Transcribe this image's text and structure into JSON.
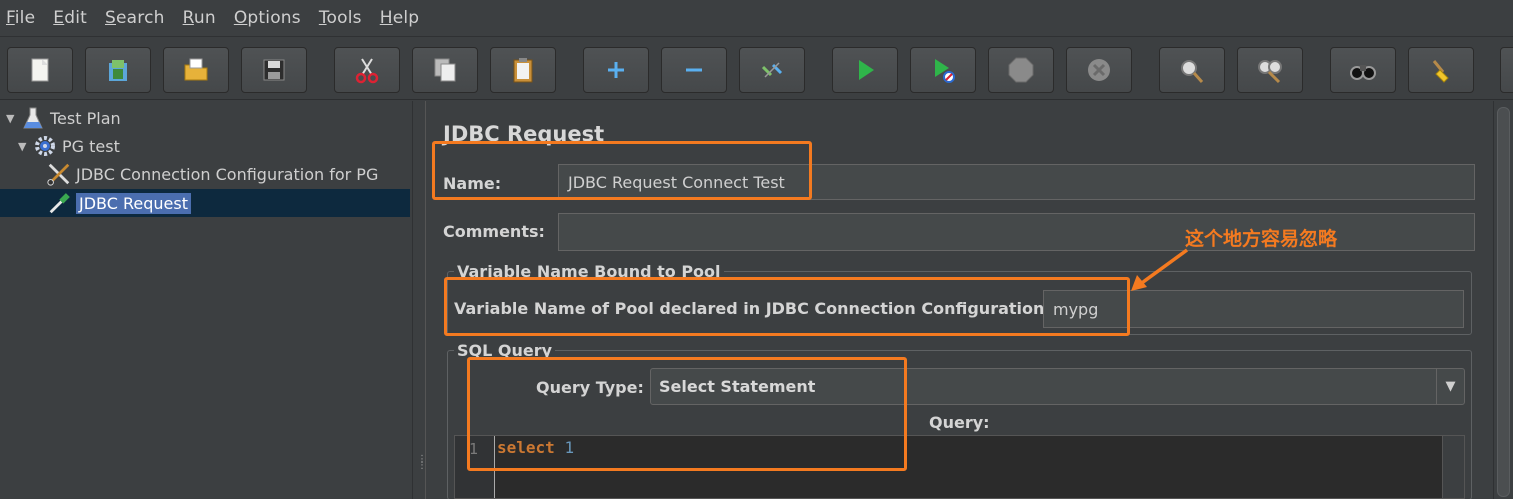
{
  "menu": {
    "items": [
      {
        "key": "F",
        "rest": "ile"
      },
      {
        "key": "E",
        "rest": "dit"
      },
      {
        "key": "S",
        "rest": "earch"
      },
      {
        "key": "R",
        "rest": "un"
      },
      {
        "key": "O",
        "rest": "ptions"
      },
      {
        "key": "T",
        "rest": "ools"
      },
      {
        "key": "H",
        "rest": "elp"
      }
    ]
  },
  "toolbar": {
    "buttons": [
      "new-icon",
      "templates-icon",
      "open-icon",
      "save-icon",
      "cut-icon",
      "copy-icon",
      "paste-icon",
      "expand-icon",
      "collapse-icon",
      "toggle-icon",
      "start-icon",
      "start-no-pause-icon",
      "stop-icon",
      "shutdown-icon",
      "clear-icon",
      "clear-all-icon",
      "search-icon",
      "reset-search-icon"
    ]
  },
  "tree": {
    "test_plan": "Test Plan",
    "thread_group": "PG test",
    "connection_config": "JDBC Connection Configuration for PG",
    "jdbc_request": "JDBC Request"
  },
  "form": {
    "title": "JDBC Request",
    "name_label": "Name:",
    "name_value": "JDBC Request Connect Test",
    "comments_label": "Comments:",
    "comments_value": "",
    "pool_group_title": "Variable Name Bound to Pool",
    "pool_label": "Variable Name of Pool declared in JDBC Connection Configuration:",
    "pool_value": "mypg",
    "sql_group_title": "SQL Query",
    "query_type_label": "Query Type:",
    "query_type_value": "Select Statement",
    "query_label": "Query:",
    "query_line_number": "1",
    "query_keyword": "select",
    "query_number": "1"
  },
  "annotation": {
    "text": "这个地方容易忽略",
    "color": "#f47a20"
  },
  "colors": {
    "background": "#3c3f41",
    "selection": "#4b6eaf",
    "keyword": "#cc7832",
    "number": "#6897bb"
  }
}
